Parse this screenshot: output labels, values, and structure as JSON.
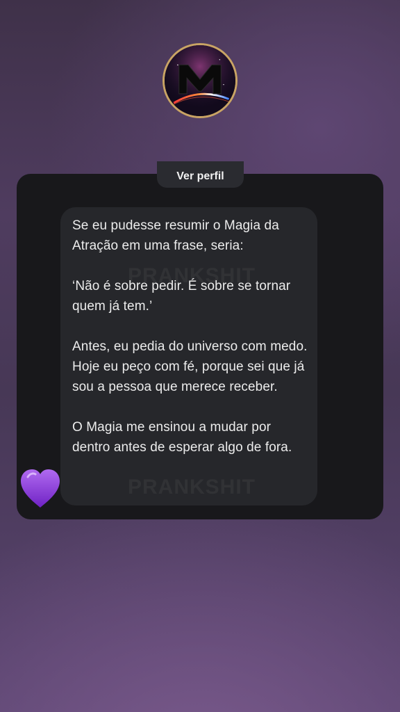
{
  "profile": {
    "avatar_icon": "magia-logo-avatar",
    "avatar_letter": "M",
    "view_profile_label": "Ver perfil"
  },
  "message": {
    "text": "Se eu pudesse resumir o Magia da Atração em uma frase, seria:\n\n‘Não é sobre pedir. É sobre se tornar quem já tem.’\n\nAntes, eu pedia do universo com medo. Hoje eu peço com fé, porque sei que já sou a pessoa que merece receber.\n\nO Magia me ensinou a mudar por dentro antes de esperar algo de fora.",
    "watermark": "PRANKSHIT"
  },
  "reaction": {
    "emoji": "💜",
    "icon": "purple-heart-icon",
    "color": "#8e3fd6"
  }
}
